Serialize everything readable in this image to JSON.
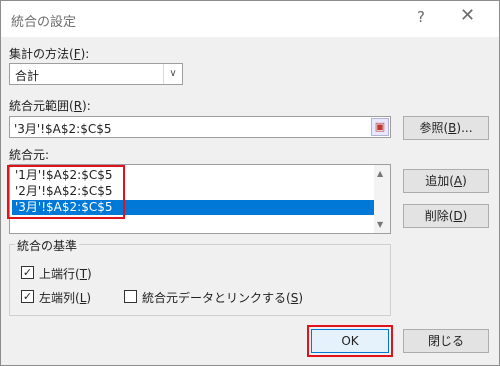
{
  "dialog": {
    "title": "統合の設定",
    "help": "?",
    "close": "✕"
  },
  "function": {
    "label": "集計の方法(",
    "accel": "F",
    "label_end": "):",
    "value": "合計"
  },
  "reference": {
    "label": "統合元範囲(",
    "accel": "R",
    "label_end": "):",
    "value": "'3月'!$A$2:$C$5",
    "browse_label": "参照(",
    "browse_accel": "B",
    "browse_end": ")..."
  },
  "all_references": {
    "label": "統合元:",
    "items": [
      "'1月'!$A$2:$C$5",
      "'2月'!$A$2:$C$5",
      "'3月'!$A$2:$C$5"
    ],
    "selected_index": 2,
    "add_label": "追加(",
    "add_accel": "A",
    "add_end": ")",
    "delete_label": "削除(",
    "delete_accel": "D",
    "delete_end": ")"
  },
  "use_labels": {
    "label": "統合の基準",
    "top_row": {
      "label": "上端行(",
      "accel": "T",
      "end": ")",
      "checked": true
    },
    "left_column": {
      "label": "左端列(",
      "accel": "L",
      "end": ")",
      "checked": true
    },
    "create_links": {
      "label": "統合元データとリンクする(",
      "accel": "S",
      "end": ")",
      "checked": false
    }
  },
  "footer": {
    "ok": "OK",
    "close": "閉じる"
  },
  "colors": {
    "highlight": "#e0131d",
    "selection": "#0078d7"
  }
}
